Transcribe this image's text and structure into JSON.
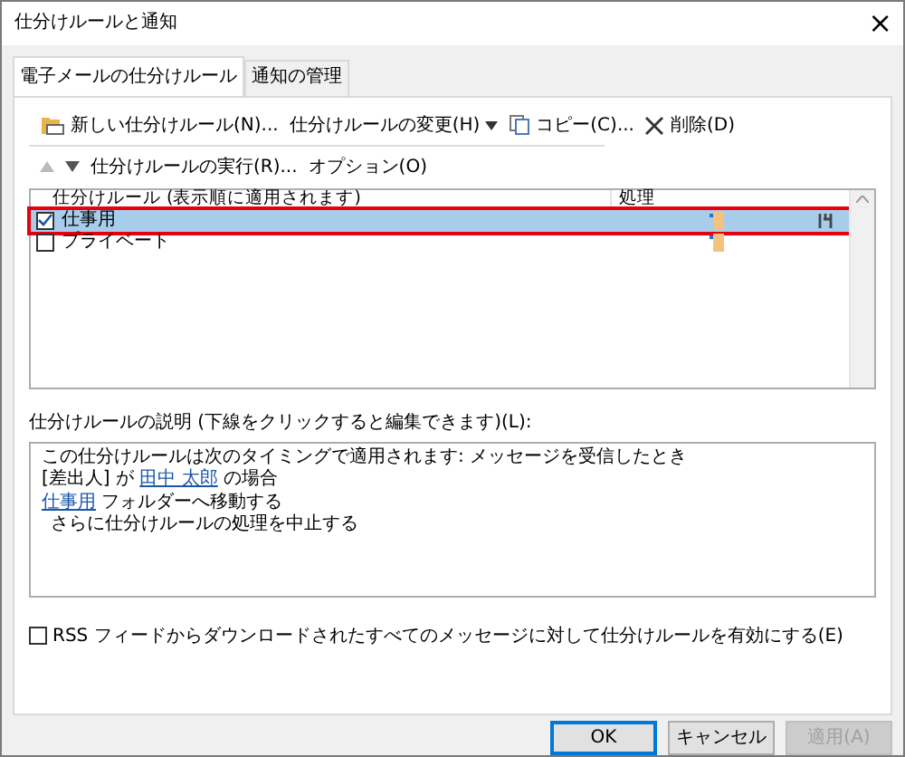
{
  "window": {
    "title": "仕分けルールと通知",
    "close": "×"
  },
  "tabs": [
    {
      "label": "電子メールの仕分けルール",
      "selected": true
    },
    {
      "label": "通知の管理",
      "selected": false
    }
  ],
  "toolbar": [
    {
      "kind": "new",
      "label": "新しい仕分けルール(N)..."
    },
    {
      "kind": "menu",
      "label": "仕分けルールの変更(H)"
    },
    {
      "kind": "copy",
      "label": "コピー(C)..."
    },
    {
      "kind": "delete",
      "label": "削除(D)"
    }
  ],
  "toolbar2": [
    {
      "kind": "up",
      "disabled": true
    },
    {
      "kind": "down",
      "disabled": false
    },
    {
      "kind": "text",
      "label": "仕分けルールの実行(R)...",
      "disabled": false
    },
    {
      "kind": "text",
      "label": "オプション(O)",
      "disabled": false
    }
  ],
  "rules_table": {
    "columns": [
      "仕分けルール (表示順に適用されます)",
      "処理"
    ],
    "rows": [
      {
        "name": "仕事用",
        "checked": true,
        "selected": true,
        "highlighted": true,
        "has_options": true
      },
      {
        "name": "プライベート",
        "checked": false,
        "selected": false,
        "highlighted": false,
        "has_options": false
      }
    ]
  },
  "description": {
    "label": "仕分けルールの説明 (下線をクリックすると編集できます)(L):",
    "lines": [
      {
        "indent": false,
        "parts": [
          {
            "text": "この仕分けルールは次のタイミングで適用されます: メッセージを受信したとき",
            "link": false
          }
        ]
      },
      {
        "indent": false,
        "parts": [
          {
            "text": "[差出人] が ",
            "link": false
          },
          {
            "text": "田中 太郎",
            "link": true
          },
          {
            "text": " の場合",
            "link": false
          }
        ]
      },
      {
        "indent": false,
        "parts": [
          {
            "text": "仕事用",
            "link": true
          },
          {
            "text": " フォルダーへ移動する",
            "link": false
          }
        ]
      },
      {
        "indent": true,
        "parts": [
          {
            "text": "さらに仕分けルールの処理を中止する",
            "link": false
          }
        ]
      }
    ]
  },
  "rss_option": {
    "label": "RSS フィードからダウンロードされたすべてのメッセージに対して仕分けルールを有効にする(E)",
    "checked": false
  },
  "buttons": [
    {
      "label": "OK",
      "default": true,
      "disabled": false
    },
    {
      "label": "キャンセル",
      "default": false,
      "disabled": false
    },
    {
      "label": "適用(A)",
      "default": false,
      "disabled": true
    }
  ]
}
